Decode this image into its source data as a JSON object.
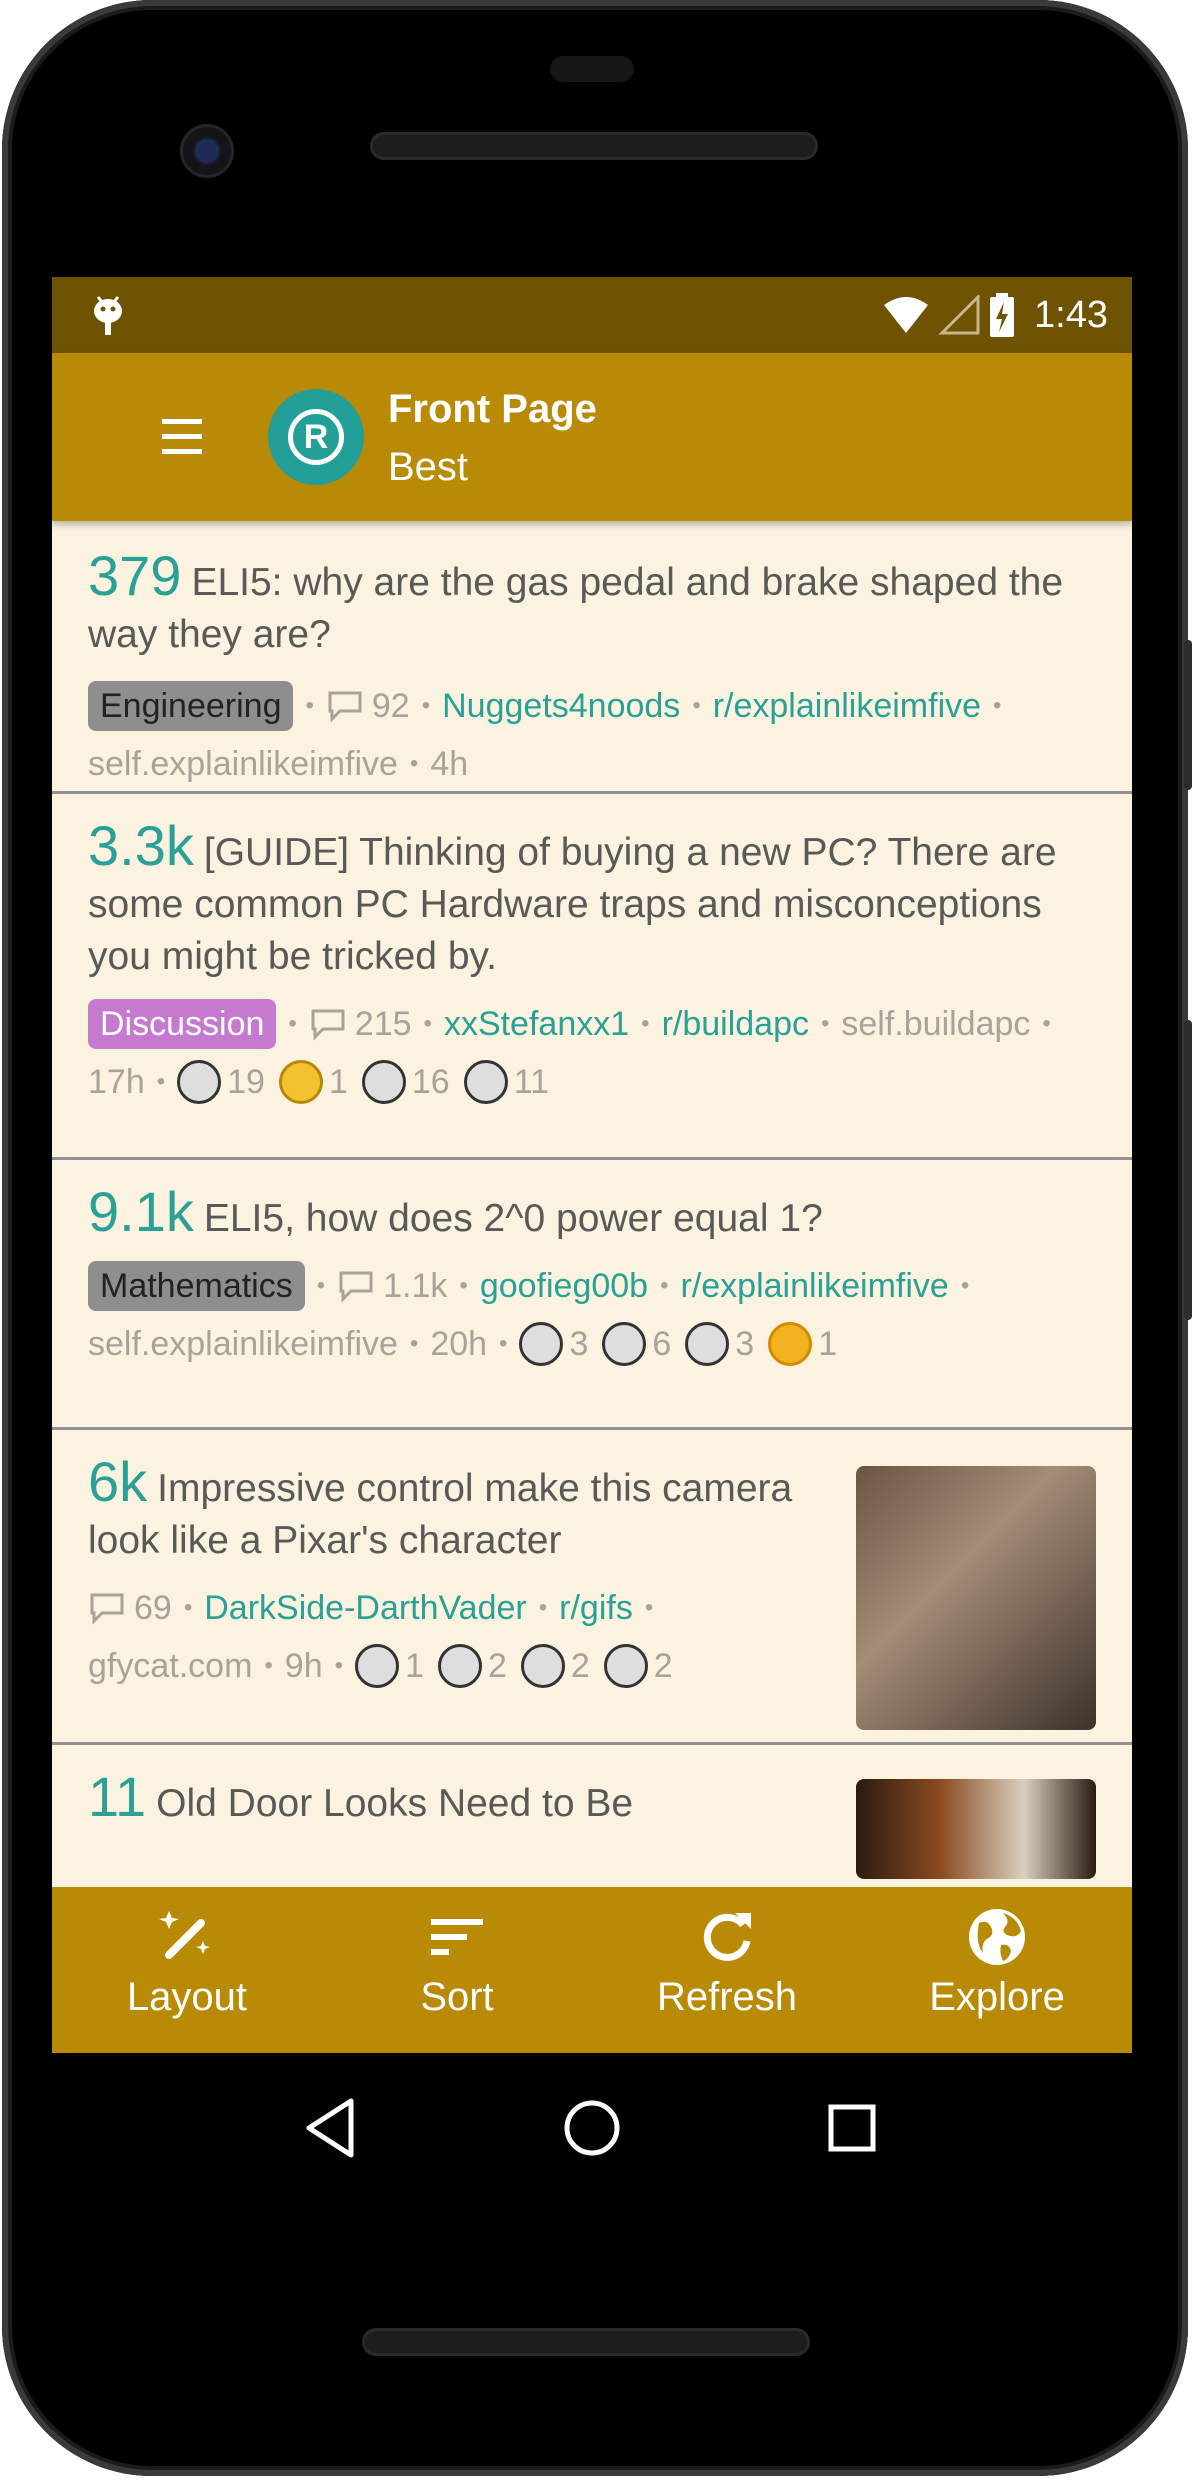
{
  "status_bar": {
    "time": "1:43"
  },
  "app_bar": {
    "title": "Front Page",
    "subtitle": "Best"
  },
  "posts": [
    {
      "score": "379",
      "title": "ELI5: why are the gas pedal and brake shaped the way they are?",
      "flair": "Engineering",
      "comments": "92",
      "author": "Nuggets4noods",
      "subreddit": "r/explainlikeimfive",
      "domain": "self.explainlikeimfive",
      "age": "4h"
    },
    {
      "score": "3.3k",
      "title": "[GUIDE] Thinking of buying a new PC? There are some common PC Hardware traps and misconceptions you might be tricked by.",
      "flair": "Discussion",
      "comments": "215",
      "author": "xxStefanxx1",
      "subreddit": "r/buildapc",
      "domain": "self.buildapc",
      "age": "17h",
      "awards": [
        {
          "icon": "silver-award-icon",
          "count": "19"
        },
        {
          "icon": "gold-award-icon",
          "count": "1"
        },
        {
          "icon": "handshake-award-icon",
          "count": "16"
        },
        {
          "icon": "wholesome-award-icon",
          "count": "11"
        }
      ]
    },
    {
      "score": "9.1k",
      "title": "ELI5, how does 2^0 power equal 1?",
      "flair": "Mathematics",
      "comments": "1.1k",
      "author": "goofieg00b",
      "subreddit": "r/explainlikeimfive",
      "domain": "self.explainlikeimfive",
      "age": "20h",
      "awards": [
        {
          "icon": "silver-award-icon",
          "count": "3"
        },
        {
          "icon": "handshake-award-icon",
          "count": "6"
        },
        {
          "icon": "wholesome-award-icon",
          "count": "3"
        },
        {
          "icon": "sun-award-icon",
          "count": "1"
        }
      ]
    },
    {
      "score": "6k",
      "title": "Impressive control make this camera look like a Pixar's character",
      "comments": "69",
      "author": "DarkSide-DarthVader",
      "subreddit": "r/gifs",
      "domain": "gfycat.com",
      "age": "9h",
      "awards": [
        {
          "icon": "rocket-award-icon",
          "count": "1"
        },
        {
          "icon": "silver-award-icon",
          "count": "2"
        },
        {
          "icon": "handshake-award-icon",
          "count": "2"
        },
        {
          "icon": "wholesome-award-icon",
          "count": "2"
        }
      ]
    },
    {
      "score": "11",
      "title": "Old Door Looks Need to Be"
    }
  ],
  "bottom_nav": [
    {
      "label": "Layout",
      "icon": "layout-wand-icon"
    },
    {
      "label": "Sort",
      "icon": "sort-icon"
    },
    {
      "label": "Refresh",
      "icon": "refresh-icon"
    },
    {
      "label": "Explore",
      "icon": "globe-icon"
    }
  ],
  "colors": {
    "primary": "#b88a05",
    "status_bar": "#6f5303",
    "background": "#fbf3df",
    "accent": "#2aa097"
  }
}
